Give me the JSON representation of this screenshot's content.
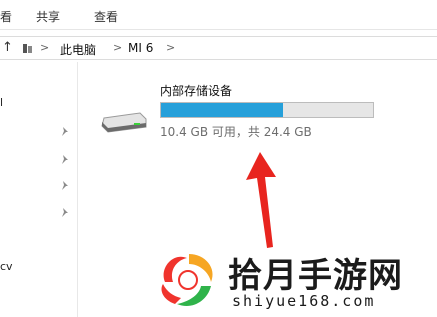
{
  "ribbon": {
    "tabs": [
      "看",
      "共享",
      "查看"
    ]
  },
  "address": {
    "crumbs": [
      "此电脑",
      "MI 6"
    ],
    "up_icon": "up-arrow-icon",
    "separator": ">"
  },
  "nav": {
    "fragments": [
      "l",
      "cv"
    ],
    "pin_icon": "pin-icon"
  },
  "drive": {
    "title": "内部存储设备",
    "subtitle": "10.4 GB 可用，共 24.4 GB",
    "used_fraction": 0.575,
    "icon": "drive-icon",
    "bar_color": "#26a0da"
  },
  "annotation": {
    "arrow_color": "#e8251f"
  },
  "watermark": {
    "brand": "拾月手游网",
    "url": "shiyue168.com"
  }
}
